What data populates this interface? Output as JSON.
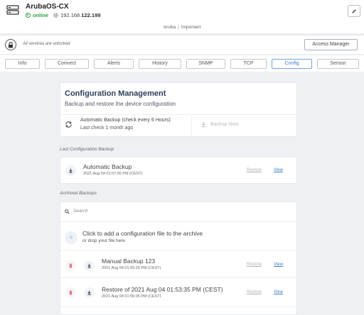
{
  "device": {
    "name": "ArubaOS-CX",
    "status": "online",
    "ip_prefix": "192.168.",
    "ip_suffix": "122.199"
  },
  "tags": [
    "Aruba",
    "Important"
  ],
  "lock_bar": {
    "message": "All services are unlocked",
    "access_manager_label": "Access Manager"
  },
  "tabs": [
    {
      "label": "Info",
      "active": false
    },
    {
      "label": "Connect",
      "active": false
    },
    {
      "label": "Alerts",
      "active": false
    },
    {
      "label": "History",
      "active": false
    },
    {
      "label": "SNMP",
      "active": false
    },
    {
      "label": "TCP",
      "active": false
    },
    {
      "label": "Config",
      "active": true
    },
    {
      "label": "Sensor",
      "active": false
    }
  ],
  "config": {
    "title": "Configuration Management",
    "subtitle": "Backup and restore the device configuration",
    "auto_backup_label": "Automatic Backup (check every 6 Hours)",
    "last_check": "Last check 1 month ago",
    "backup_now_label": "Backup Now"
  },
  "last_backup": {
    "section_label": "Last Configuration Backup",
    "title": "Automatic Backup",
    "date": "2021 Aug 04 01:57:55 PM (CEST)",
    "restore_label": "Restore",
    "view_label": "View"
  },
  "archived": {
    "section_label": "Archived Backups",
    "search_placeholder": "Search",
    "add_title": "Click to add a configuration file to the archive",
    "add_sub": "or drop your file here",
    "items": [
      {
        "title": "Manual Backup 123",
        "date": "2021 Aug 04 01:55:25 PM (CEST)",
        "restore_label": "Restore",
        "view_label": "View"
      },
      {
        "title": "Restore of 2021 Aug 04 01:53:35 PM (CEST)",
        "date": "2021 Aug 04 01:55:05 PM (CEST)",
        "restore_label": "Restore",
        "view_label": "View"
      }
    ]
  },
  "colors": {
    "online": "#2ea043",
    "accent": "#3b7bbf",
    "title": "#2d3f5a",
    "delete": "#e07a8a"
  }
}
